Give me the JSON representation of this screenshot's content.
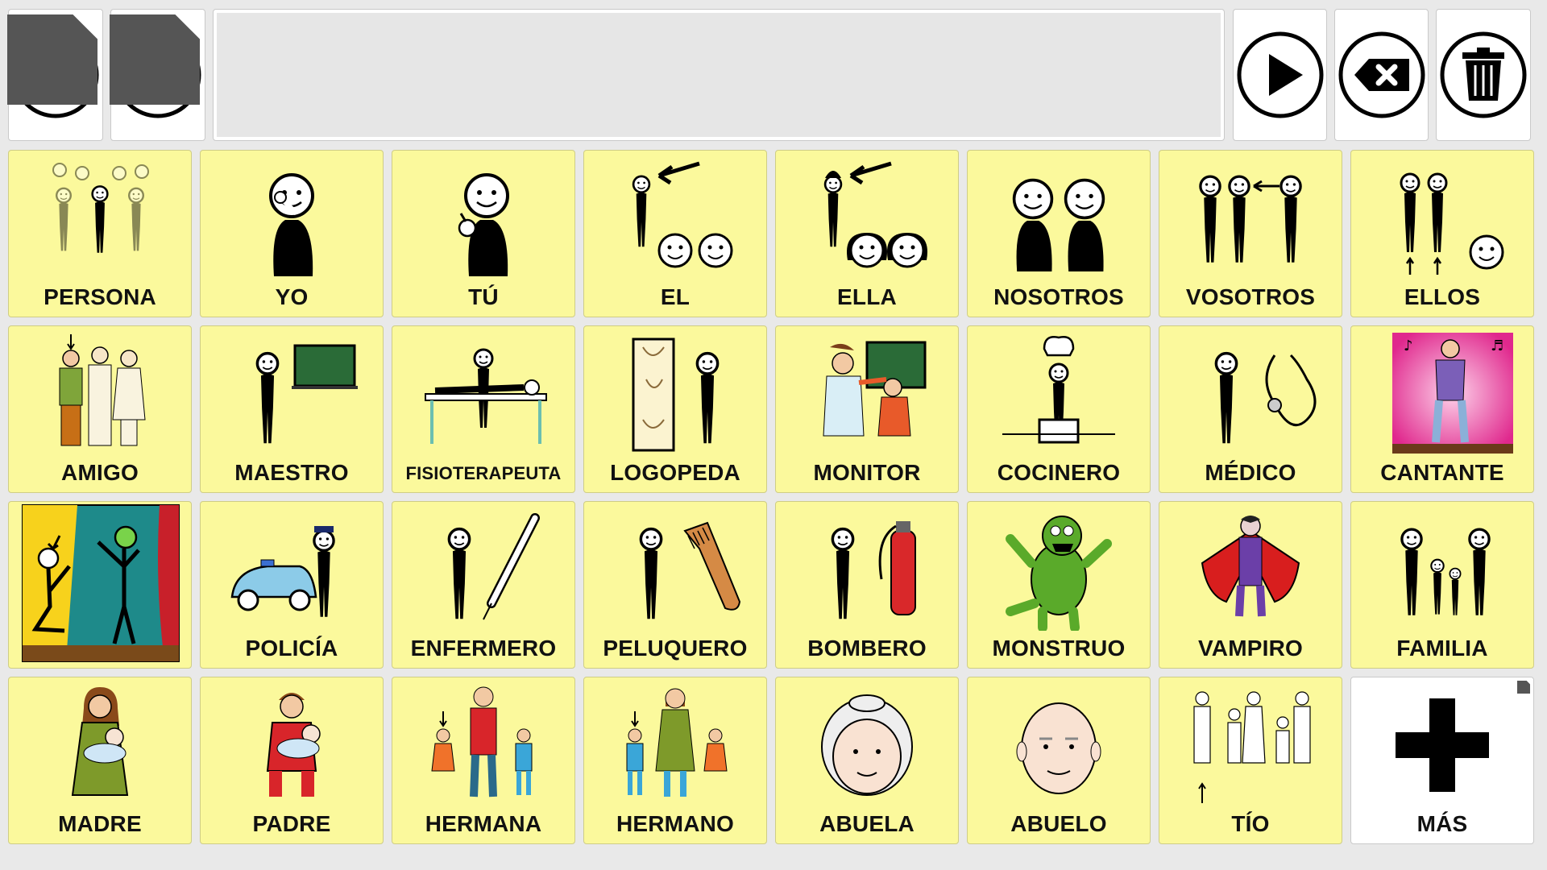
{
  "toolbar": {
    "home_icon": "home-icon",
    "back_icon": "undo-icon",
    "play_icon": "play-icon",
    "backspace_icon": "backspace-icon",
    "delete_icon": "trash-icon"
  },
  "sentence_bar": {
    "text": ""
  },
  "colors": {
    "cell": "#fbf99c",
    "background": "#e9e9e9",
    "more_cell": "#ffffff"
  },
  "grid": {
    "cells": [
      {
        "label": "PERSONA",
        "icon": "people-group-icon"
      },
      {
        "label": "YO",
        "icon": "person-pointing-self-icon"
      },
      {
        "label": "TÚ",
        "icon": "person-pointing-you-icon"
      },
      {
        "label": "EL",
        "icon": "he-icon"
      },
      {
        "label": "ELLA",
        "icon": "she-icon"
      },
      {
        "label": "NOSOTROS",
        "icon": "we-icon"
      },
      {
        "label": "VOSOTROS",
        "icon": "you-plural-icon"
      },
      {
        "label": "ELLOS",
        "icon": "they-icon"
      },
      {
        "label": "AMIGO",
        "icon": "friends-icon"
      },
      {
        "label": "MAESTRO",
        "icon": "teacher-icon"
      },
      {
        "label": "FISIOTERAPEUTA",
        "icon": "physiotherapist-icon"
      },
      {
        "label": "LOGOPEDA",
        "icon": "speech-therapist-icon"
      },
      {
        "label": "MONITOR",
        "icon": "monitor-icon"
      },
      {
        "label": "COCINERO",
        "icon": "cook-icon"
      },
      {
        "label": "MÉDICO",
        "icon": "doctor-icon"
      },
      {
        "label": "CANTANTE",
        "icon": "singer-icon"
      },
      {
        "label": "",
        "icon": "actor-stage-icon"
      },
      {
        "label": "POLICÍA",
        "icon": "police-icon"
      },
      {
        "label": "ENFERMERO",
        "icon": "nurse-icon"
      },
      {
        "label": "PELUQUERO",
        "icon": "hairdresser-icon"
      },
      {
        "label": "BOMBERO",
        "icon": "firefighter-icon"
      },
      {
        "label": "MONSTRUO",
        "icon": "monster-icon"
      },
      {
        "label": "VAMPIRO",
        "icon": "vampire-icon"
      },
      {
        "label": "FAMILIA",
        "icon": "family-icon"
      },
      {
        "label": "MADRE",
        "icon": "mother-icon"
      },
      {
        "label": "PADRE",
        "icon": "father-icon"
      },
      {
        "label": "HERMANA",
        "icon": "sister-icon"
      },
      {
        "label": "HERMANO",
        "icon": "brother-icon"
      },
      {
        "label": "ABUELA",
        "icon": "grandmother-icon"
      },
      {
        "label": "ABUELO",
        "icon": "grandfather-icon"
      },
      {
        "label": "TÍO",
        "icon": "uncle-icon"
      },
      {
        "label": "MÁS",
        "icon": "plus-icon"
      }
    ]
  }
}
